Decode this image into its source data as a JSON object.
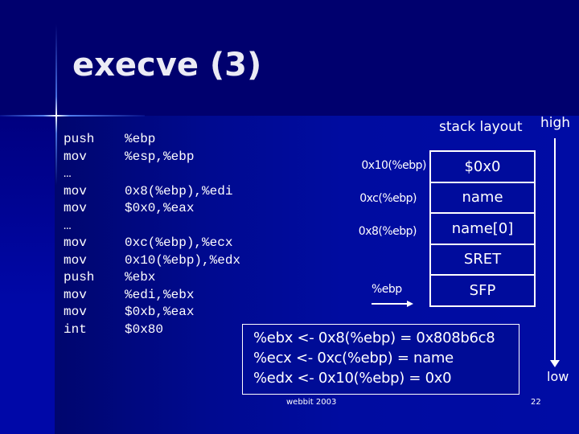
{
  "slide": {
    "title": "execve (3)",
    "footer": {
      "author": "webbit 2003",
      "page_number": "22"
    }
  },
  "code": [
    {
      "op": "push",
      "arg": "%ebp"
    },
    {
      "op": "mov",
      "arg": "%esp,%ebp"
    },
    {
      "op": "…",
      "arg": ""
    },
    {
      "op": "mov",
      "arg": "0x8(%ebp),%edi"
    },
    {
      "op": "mov",
      "arg": "$0x0,%eax"
    },
    {
      "op": "…",
      "arg": ""
    },
    {
      "op": "mov",
      "arg": "0xc(%ebp),%ecx"
    },
    {
      "op": "mov",
      "arg": "0x10(%ebp),%edx"
    },
    {
      "op": "push",
      "arg": "%ebx"
    },
    {
      "op": "mov",
      "arg": "%edi,%ebx"
    },
    {
      "op": "mov",
      "arg": "$0xb,%eax"
    },
    {
      "op": "int",
      "arg": "$0x80"
    }
  ],
  "stack": {
    "title": "stack layout",
    "high_label": "high",
    "low_label": "low",
    "cells": [
      "$0x0",
      "name",
      "name[0]",
      "SRET",
      "SFP"
    ],
    "offsets": [
      "0x10(%ebp)",
      "0xc(%ebp)",
      "0x8(%ebp)"
    ],
    "ebp_pointer": "%ebp"
  },
  "results": [
    "%ebx <- 0x8(%ebp) = 0x808b6c8",
    "%ecx <- 0xc(%ebp) = name",
    "%edx <- 0x10(%ebp) = 0x0"
  ]
}
